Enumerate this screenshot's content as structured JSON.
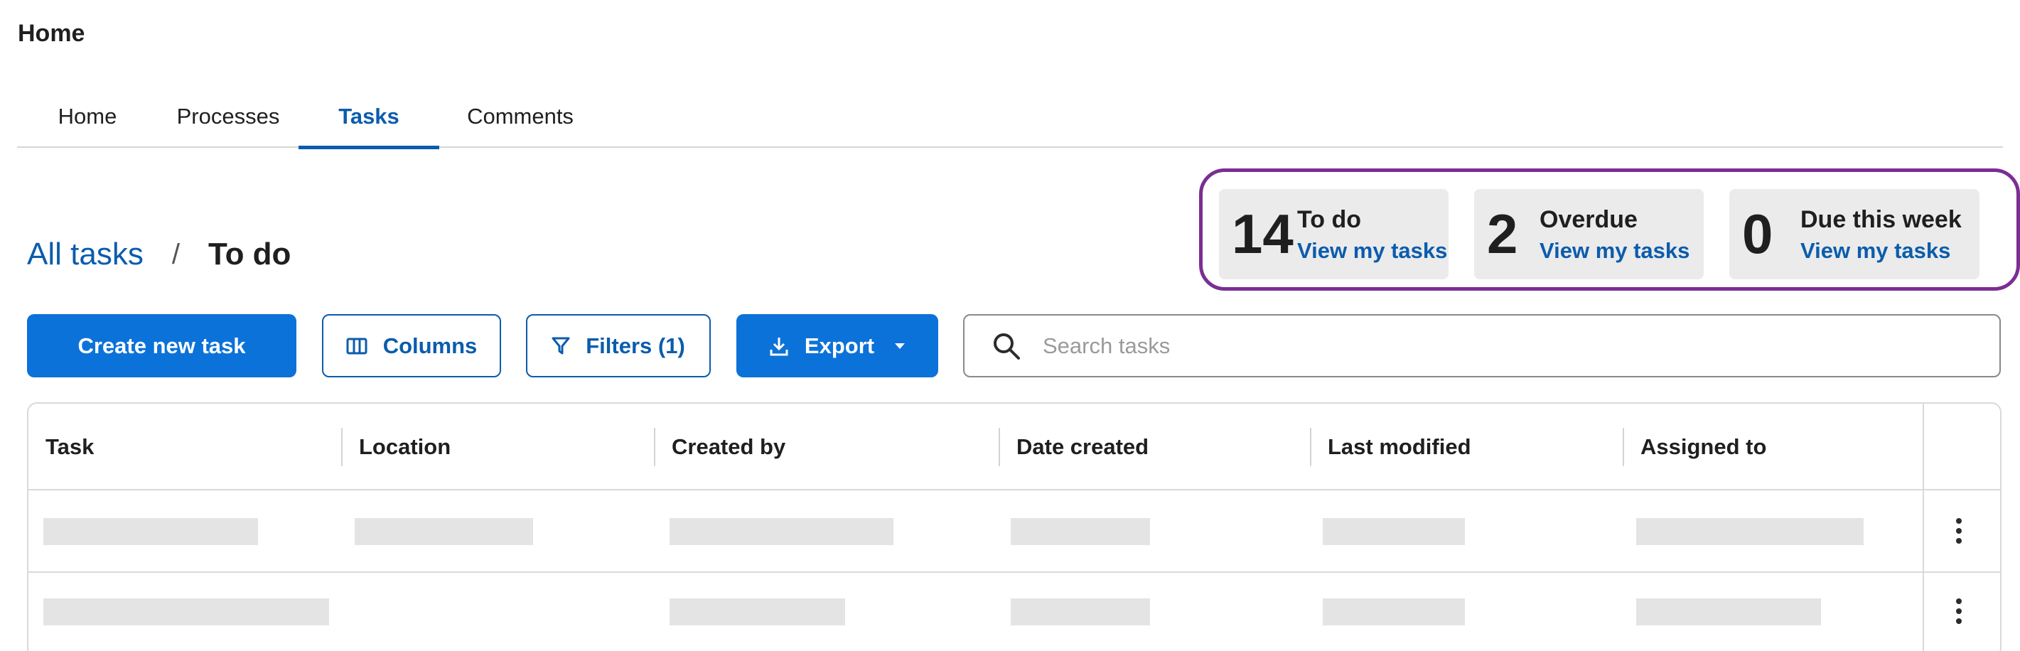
{
  "page": {
    "heading": "Home"
  },
  "tabs": [
    {
      "label": "Home",
      "active": false
    },
    {
      "label": "Processes",
      "active": false
    },
    {
      "label": "Tasks",
      "active": true
    },
    {
      "label": "Comments",
      "active": false
    }
  ],
  "breadcrumb": {
    "parent": "All tasks",
    "separator": "/",
    "current": "To do"
  },
  "summary": [
    {
      "count": "14",
      "label": "To do",
      "link": "View my tasks"
    },
    {
      "count": "2",
      "label": "Overdue",
      "link": "View my tasks"
    },
    {
      "count": "0",
      "label": "Due this week",
      "link": "View my tasks"
    }
  ],
  "toolbar": {
    "create_label": "Create new task",
    "columns_label": "Columns",
    "filters_label": "Filters (1)",
    "export_label": "Export"
  },
  "search": {
    "placeholder": "Search tasks",
    "value": ""
  },
  "table": {
    "columns": [
      "Task",
      "Location",
      "Created by",
      "Date created",
      "Last modified",
      "Assigned to"
    ]
  },
  "colors": {
    "primary": "#0b72d9",
    "link": "#0b5cad",
    "highlight": "#7b2e93",
    "skeleton": "#e4e4e4"
  },
  "icons": {
    "columns": "columns-icon",
    "filters": "filter-icon",
    "export": "download-icon",
    "export_menu": "caret-down-icon",
    "search": "search-icon",
    "row_actions": "more-vertical-icon"
  }
}
